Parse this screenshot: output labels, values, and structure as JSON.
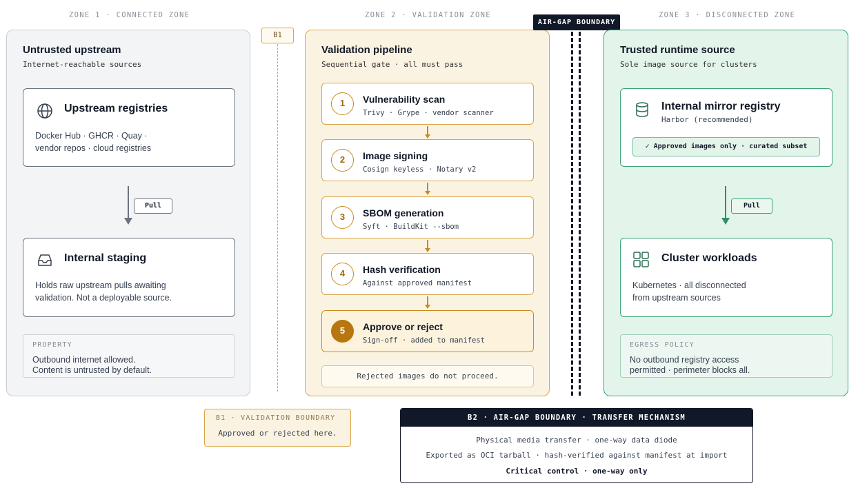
{
  "zones": {
    "z1_label": "ZONE 1 · CONNECTED ZONE",
    "z2_label": "ZONE 2 · VALIDATION ZONE",
    "z3_label": "ZONE 3 · DISCONNECTED ZONE"
  },
  "zone1": {
    "title": "Untrusted upstream",
    "subtitle": "Internet-reachable sources",
    "upstream": {
      "icon": "globe-icon",
      "title": "Upstream registries",
      "line1": "Docker Hub · GHCR · Quay ·",
      "line2": "vendor repos · cloud registries"
    },
    "pull_label": "Pull",
    "staging": {
      "icon": "inbox-icon",
      "title": "Internal staging",
      "line1": "Holds raw upstream pulls awaiting",
      "line2": "validation. Not a deployable source."
    },
    "property": {
      "label": "PROPERTY",
      "line1": "Outbound internet allowed.",
      "line2": "Content is untrusted by default."
    }
  },
  "b1_tag": "B1",
  "zone2": {
    "title": "Validation pipeline",
    "subtitle": "Sequential gate · all must pass",
    "steps": [
      {
        "num": "1",
        "title": "Vulnerability scan",
        "sub": "Trivy · Grype · vendor scanner"
      },
      {
        "num": "2",
        "title": "Image signing",
        "sub": "Cosign keyless · Notary v2"
      },
      {
        "num": "3",
        "title": "SBOM generation",
        "sub": "Syft · BuildKit --sbom"
      },
      {
        "num": "4",
        "title": "Hash verification",
        "sub": "Against approved manifest"
      },
      {
        "num": "5",
        "title": "Approve or reject",
        "sub": "Sign-off · added to manifest"
      }
    ],
    "reject_note": "Rejected images do not proceed."
  },
  "airgap_tag": "AIR-GAP BOUNDARY",
  "zone3": {
    "title": "Trusted runtime source",
    "subtitle": "Sole image source for clusters",
    "mirror": {
      "icon": "database-icon",
      "title": "Internal mirror registry",
      "sub": "Harbor (recommended)",
      "badge": "✓ Approved images only · curated subset"
    },
    "pull_label": "Pull",
    "workloads": {
      "icon": "grid-icon",
      "title": "Cluster workloads",
      "line1": "Kubernetes · all disconnected",
      "line2": "from upstream sources"
    },
    "egress": {
      "label": "EGRESS POLICY",
      "line1": "No outbound registry access",
      "line2": "permitted · perimeter blocks all."
    }
  },
  "b1_box": {
    "title": "B1 · VALIDATION BOUNDARY",
    "text": "Approved or rejected here."
  },
  "b2_box": {
    "title": "B2 · AIR-GAP BOUNDARY · TRANSFER MECHANISM",
    "line1": "Physical media transfer · one-way data diode",
    "line2": "Exported as OCI tarball · hash-verified against manifest at import",
    "line3": "Critical control · one-way only"
  },
  "colors": {
    "zone1_border": "#c9ccd2",
    "zone2_accent": "#d9a54a",
    "zone3_accent": "#3aa477",
    "dark": "#111827"
  }
}
